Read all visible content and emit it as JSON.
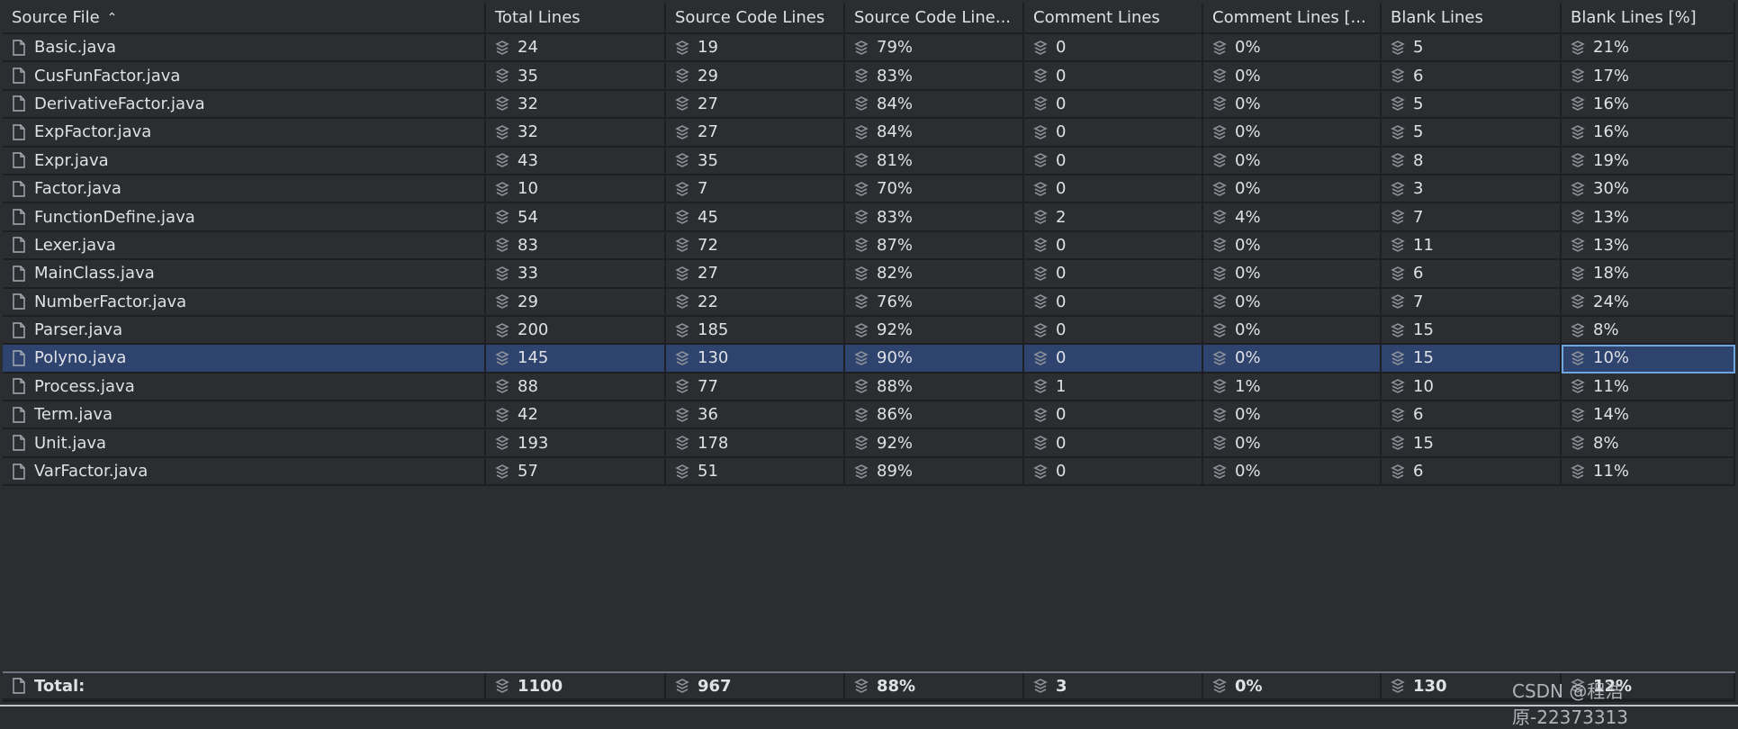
{
  "columns": [
    "Source File",
    "Total Lines",
    "Source Code Line...",
    "Comment Lines",
    "Comment Lines [...",
    "Blank Lines",
    "Blank Lines [%]"
  ],
  "header": {
    "c0": "Source File",
    "sort": "^",
    "c1": "Total Lines",
    "c2": "Source Code Lines",
    "c3": "Source Code Line...",
    "c4": "Comment Lines",
    "c5": "Comment Lines [...",
    "c6": "Blank Lines",
    "c7": "Blank Lines [%]"
  },
  "rows": [
    [
      "Basic.java",
      "24",
      "19",
      "79%",
      "0",
      "0%",
      "5",
      "21%"
    ],
    [
      "CusFunFactor.java",
      "35",
      "29",
      "83%",
      "0",
      "0%",
      "6",
      "17%"
    ],
    [
      "DerivativeFactor.java",
      "32",
      "27",
      "84%",
      "0",
      "0%",
      "5",
      "16%"
    ],
    [
      "ExpFactor.java",
      "32",
      "27",
      "84%",
      "0",
      "0%",
      "5",
      "16%"
    ],
    [
      "Expr.java",
      "43",
      "35",
      "81%",
      "0",
      "0%",
      "8",
      "19%"
    ],
    [
      "Factor.java",
      "10",
      "7",
      "70%",
      "0",
      "0%",
      "3",
      "30%"
    ],
    [
      "FunctionDefine.java",
      "54",
      "45",
      "83%",
      "2",
      "4%",
      "7",
      "13%"
    ],
    [
      "Lexer.java",
      "83",
      "72",
      "87%",
      "0",
      "0%",
      "11",
      "13%"
    ],
    [
      "MainClass.java",
      "33",
      "27",
      "82%",
      "0",
      "0%",
      "6",
      "18%"
    ],
    [
      "NumberFactor.java",
      "29",
      "22",
      "76%",
      "0",
      "0%",
      "7",
      "24%"
    ],
    [
      "Parser.java",
      "200",
      "185",
      "92%",
      "0",
      "0%",
      "15",
      "8%"
    ],
    [
      "Polyno.java",
      "145",
      "130",
      "90%",
      "0",
      "0%",
      "15",
      "10%"
    ],
    [
      "Process.java",
      "88",
      "77",
      "88%",
      "1",
      "1%",
      "10",
      "11%"
    ],
    [
      "Term.java",
      "42",
      "36",
      "86%",
      "0",
      "0%",
      "6",
      "14%"
    ],
    [
      "Unit.java",
      "193",
      "178",
      "92%",
      "0",
      "0%",
      "15",
      "8%"
    ],
    [
      "VarFactor.java",
      "57",
      "51",
      "89%",
      "0",
      "0%",
      "6",
      "11%"
    ]
  ],
  "selected_row": 11,
  "total": [
    "Total:",
    "1100",
    "967",
    "88%",
    "3",
    "0%",
    "130",
    "12%"
  ],
  "watermark": "CSDN @程浩原-22373313",
  "colors": {
    "background": "#2b2d30",
    "selected": "#2e436e",
    "grid": "#1e1f22",
    "focus": "#6ea6e0"
  },
  "icons": {
    "file": "file-icon",
    "metric": "layers-icon"
  }
}
